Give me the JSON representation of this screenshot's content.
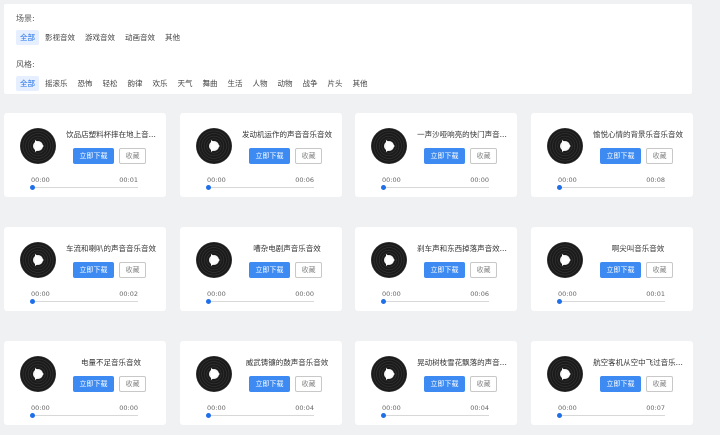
{
  "filters": {
    "scene": {
      "label": "场景:",
      "options": [
        "全部",
        "影视音效",
        "游戏音效",
        "动画音效",
        "其他"
      ],
      "active": 0
    },
    "style": {
      "label": "风格:",
      "options": [
        "全部",
        "摇滚乐",
        "恐怖",
        "轻松",
        "韵律",
        "欢乐",
        "天气",
        "舞曲",
        "生活",
        "人物",
        "动物",
        "战争",
        "片头",
        "其他"
      ],
      "active": 0
    }
  },
  "buttons": {
    "download": "立即下载",
    "favorite": "收藏"
  },
  "colors": {
    "accent": "#3d8bf2",
    "active_chip_bg": "#e6efff",
    "active_chip_text": "#1e6fe8"
  },
  "sounds": [
    {
      "title": "饮品店塑料杯摔在地上音...",
      "current": "00:00",
      "duration": "00:01"
    },
    {
      "title": "发动机运作的声音音乐音效",
      "current": "00:00",
      "duration": "00:06"
    },
    {
      "title": "一声沙哑响亮的快门声音...",
      "current": "00:00",
      "duration": "00:00"
    },
    {
      "title": "愉悦心情的背景乐音乐音效",
      "current": "00:00",
      "duration": "00:08"
    },
    {
      "title": "车流和喇叭的声音音乐音效",
      "current": "00:00",
      "duration": "00:02"
    },
    {
      "title": "嘈杂电剧声音乐音效",
      "current": "00:00",
      "duration": "00:00"
    },
    {
      "title": "刹车声和东西掉落声音效...",
      "current": "00:00",
      "duration": "00:06"
    },
    {
      "title": "啊尖叫音乐音效",
      "current": "00:00",
      "duration": "00:01"
    },
    {
      "title": "电量不足音乐音效",
      "current": "00:00",
      "duration": "00:00"
    },
    {
      "title": "威武铸镰的鼓声音乐音效",
      "current": "00:00",
      "duration": "00:04"
    },
    {
      "title": "晃动树枝雪花飘落的声音...",
      "current": "00:00",
      "duration": "00:04"
    },
    {
      "title": "航空客机从空中飞过音乐...",
      "current": "00:00",
      "duration": "00:07"
    }
  ]
}
